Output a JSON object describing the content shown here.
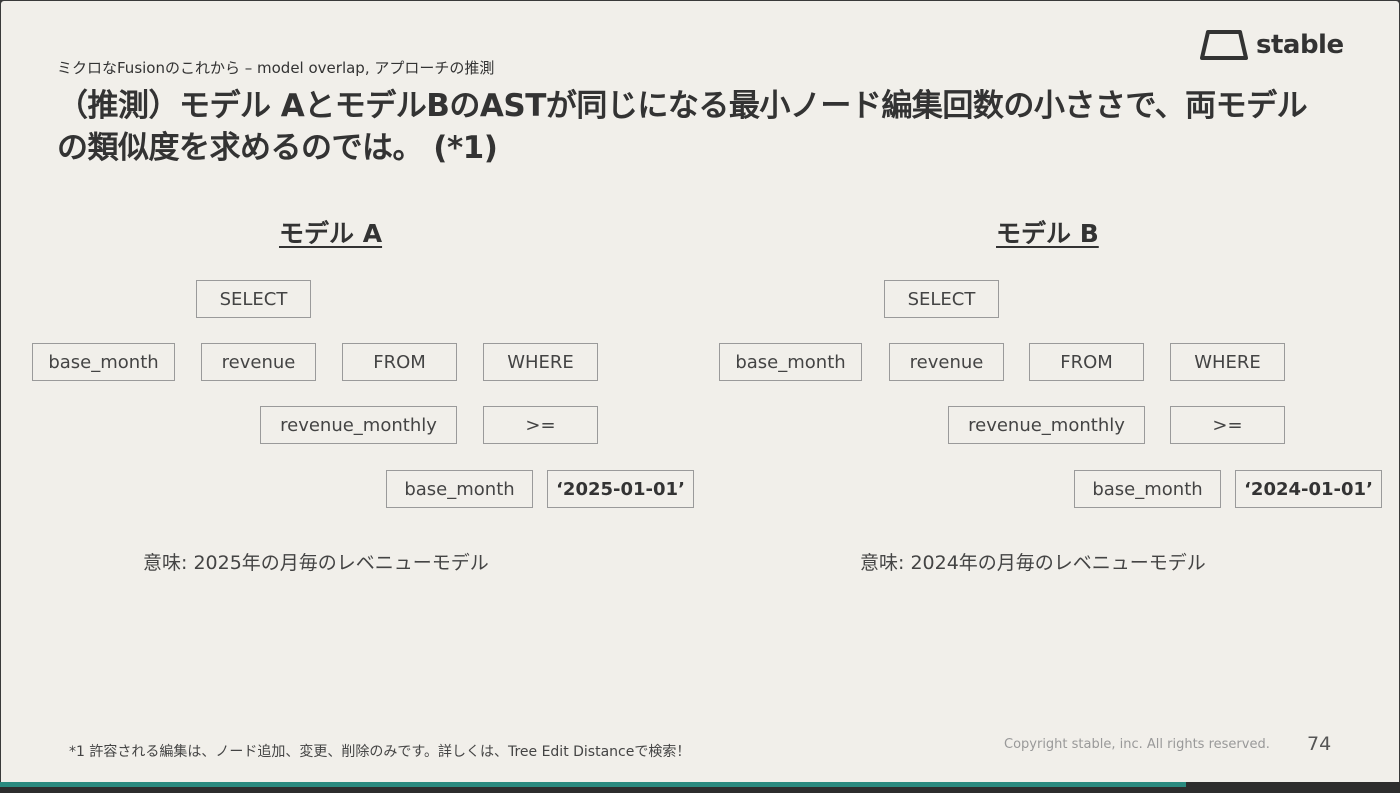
{
  "slide": {
    "subtitle": "ミクロなFusionのこれから – model overlap, アプローチの推測",
    "title": "（推測）モデル AとモデルBのASTが同じになる最小ノード編集回数の小ささで、両モデルの類似度を求めるのでは。 (*1)",
    "logo_text": "stable",
    "logo_icon": "trapezoid-logo-icon"
  },
  "model_a": {
    "heading": "モデル A",
    "nodes": {
      "select": "SELECT",
      "base_month": "base_month",
      "revenue": "revenue",
      "from": "FROM",
      "where": "WHERE",
      "revenue_monthly": "revenue_monthly",
      "op": ">=",
      "base_month_2": "base_month",
      "date": "‘2025-01-01’"
    },
    "meaning": "意味: 2025年の月毎のレベニューモデル"
  },
  "model_b": {
    "heading": "モデル B",
    "nodes": {
      "select": "SELECT",
      "base_month": "base_month",
      "revenue": "revenue",
      "from": "FROM",
      "where": "WHERE",
      "revenue_monthly": "revenue_monthly",
      "op": ">=",
      "base_month_2": "base_month",
      "date": "‘2024-01-01’"
    },
    "meaning": "意味: 2024年の月毎のレベニューモデル"
  },
  "footer": {
    "footnote": "*1 許容される編集は、ノード追加、変更、削除のみです。詳しくは、Tree Edit Distanceで検索！",
    "copyright": "Copyright stable, inc. All rights reserved.",
    "page_number": "74",
    "progress_fraction": 0.847,
    "progress_color": "#2a8a7f"
  }
}
